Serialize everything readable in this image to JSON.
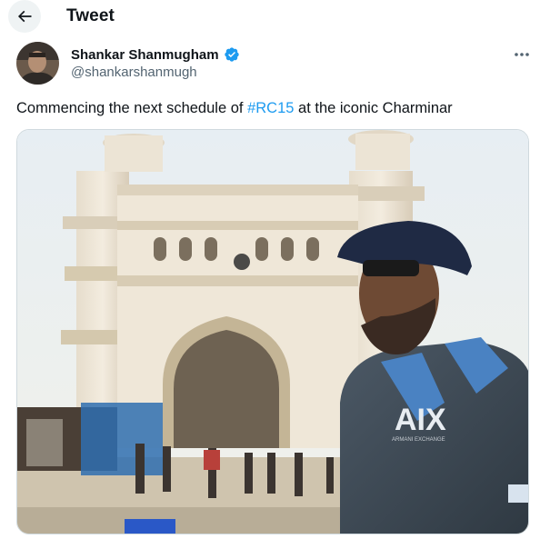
{
  "header": {
    "title": "Tweet",
    "back_icon": "arrow-left-icon"
  },
  "author": {
    "name": "Shankar Shanmugham",
    "handle": "@shankarshanmugh",
    "verified_icon": "verified-badge-icon",
    "verified_color": "#1d9bf0"
  },
  "tweet": {
    "text_before": "Commencing the next schedule of ",
    "hashtag": "#RC15",
    "text_after": " at the iconic Charminar"
  },
  "media": {
    "description_icon": "photo-charminar-man-cap",
    "shirt_logo": "AIX",
    "shirt_sublabel": "ARMANI EXCHANGE"
  },
  "colors": {
    "accent": "#1d9bf0",
    "text_primary": "#0f1419",
    "text_secondary": "#536471"
  }
}
